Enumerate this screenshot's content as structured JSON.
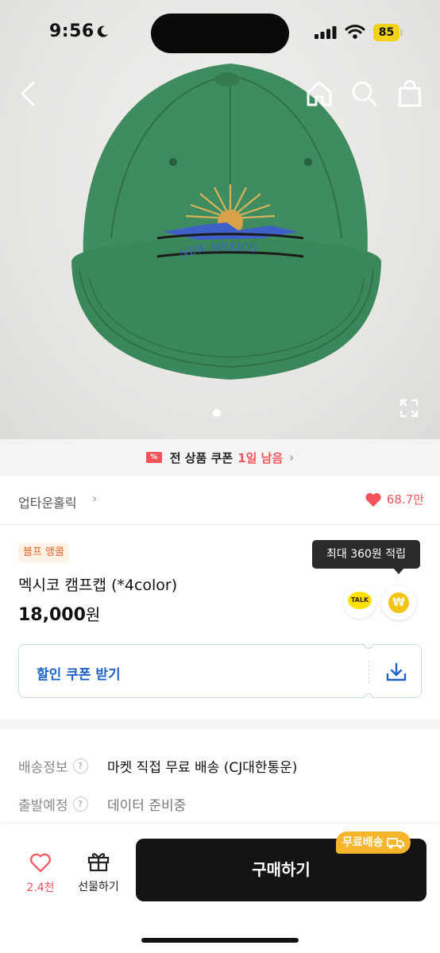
{
  "status_bar": {
    "time": "9:56",
    "battery": "85"
  },
  "nav": {
    "back": "back",
    "home": "home",
    "search": "search",
    "cart": "cart"
  },
  "gallery": {
    "dots": 5,
    "active_index": 2
  },
  "coupon_banner": {
    "text": "전 상품 쿠폰",
    "highlight": "1일 남음",
    "chevron": "›"
  },
  "shop": {
    "name": "업타운홀릭",
    "chevron": "›",
    "likes": "68.7만"
  },
  "product": {
    "badge": "블프 앵콜",
    "title": "멕시코 캠프캡 (*4color)",
    "price": "18,000",
    "currency": "원",
    "points_tooltip": "최대 360원 적립",
    "talk_label": "TALK",
    "point_symbol": "₩"
  },
  "coupon_box": {
    "label": "할인 쿠폰 받기"
  },
  "info": [
    {
      "key": "배송정보",
      "value": "마켓 직접 무료 배송 (CJ대한통운)"
    },
    {
      "key": "출발예정",
      "value": "데이터 준비중"
    }
  ],
  "bottom_bar": {
    "wish_count": "2.4천",
    "gift_label": "선물하기",
    "buy_label": "구매하기",
    "free_shipping": "무료배송"
  },
  "colors": {
    "accent_red": "#f2545b",
    "coupon_blue": "#1f63c6",
    "badge_orange": "#e0622a",
    "free_ship_yellow": "#f7b52b",
    "cap_green": "#3d8a5e"
  }
}
